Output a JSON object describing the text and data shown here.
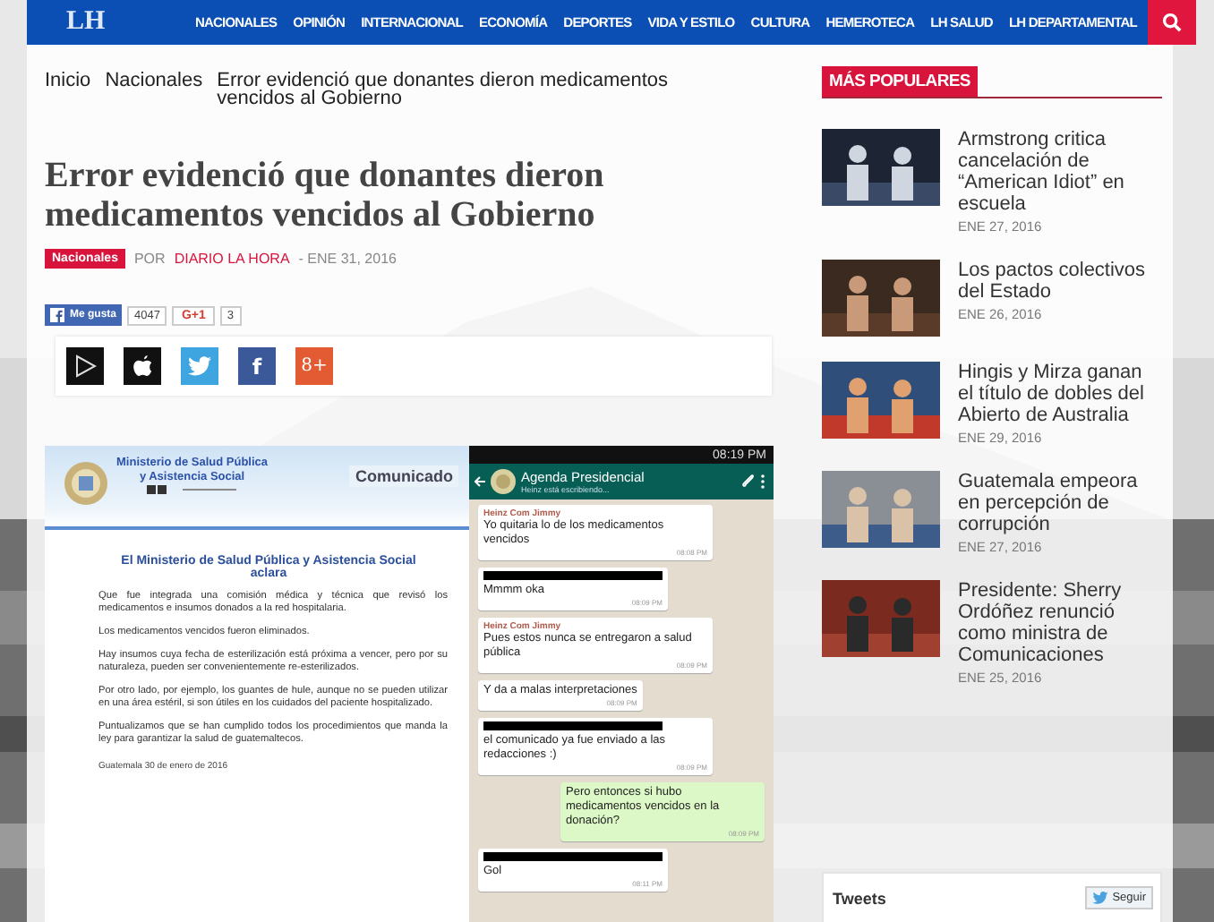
{
  "nav": {
    "logo": "LH",
    "items": [
      "NACIONALES",
      "OPINIÓN",
      "INTERNACIONAL",
      "ECONOMÍA",
      "DEPORTES",
      "VIDA Y ESTILO",
      "CULTURA",
      "HEMEROTECA",
      "LH SALUD",
      "LH DEPARTAMENTAL"
    ]
  },
  "breadcrumb": [
    "Inicio",
    "Nacionales",
    "Error evidenció que donantes dieron medicamentos vencidos al Gobierno"
  ],
  "article": {
    "title": "Error evidenció que donantes dieron medicamentos vencidos al Gobierno",
    "category": "Nacionales",
    "by": "POR",
    "author": "DIARIO LA HORA",
    "date": "- ENE 31, 2016"
  },
  "social": {
    "like_label": "Me gusta",
    "like_count": "4047",
    "plus_label": "G+1",
    "plus_count": "3"
  },
  "share_buttons": [
    {
      "kind": "play"
    },
    {
      "kind": "apple"
    },
    {
      "kind": "twitter"
    },
    {
      "kind": "facebook",
      "glyph": "f"
    },
    {
      "kind": "gplus",
      "glyph": "8+"
    }
  ],
  "communique": {
    "ministry": [
      "Ministerio de Salud Pública",
      "y Asistencia Social"
    ],
    "badge": "Comunicado",
    "heading": "El Ministerio de Salud Pública y Asistencia Social aclara",
    "paragraphs": [
      "Que fue integrada una comisión médica y técnica que revisó los medicamentos e insumos donados a la red hospitalaria.",
      "Los medicamentos vencidos fueron eliminados.",
      "Hay insumos cuya fecha de esterilización está próxima a vencer, pero por su naturaleza, pueden ser convenientemente re-esterilizados.",
      "Por otro lado, por ejemplo, los guantes de hule, aunque no se pueden utilizar en una área estéril, si son útiles en los cuidados del paciente hospitalizado.",
      "Puntualizamos que se han cumplido todos los procedimientos que manda la ley para garantizar la salud de guatemaltecos."
    ],
    "dateline": "Guatemala 30 de enero de 2016"
  },
  "chat": {
    "clock": "08:19 PM",
    "title": "Agenda Presidencial",
    "status": "Heinz está escribiendo...",
    "messages": [
      {
        "sender": "Heinz Com Jimmy",
        "text": "Yo quitaria lo de los medicamentos vencidos",
        "time": "08:08 PM",
        "outgoing": false,
        "redacted": false
      },
      {
        "text": "Mmmm oka",
        "time": "08:09 PM",
        "outgoing": false,
        "redacted": true
      },
      {
        "sender": "Heinz Com Jimmy",
        "text": "Pues estos nunca se entregaron a salud pública",
        "time": "08:09 PM",
        "outgoing": false,
        "redacted": false
      },
      {
        "text": "Y da a malas interpretaciones",
        "time": "08:09 PM",
        "outgoing": false,
        "redacted": false
      },
      {
        "text": "el comunicado ya fue enviado a las redacciones :)",
        "time": "08:09 PM",
        "outgoing": false,
        "redacted": true
      },
      {
        "text": "Pero  entonces si hubo medicamentos vencidos en la donación?",
        "time": "08:09 PM",
        "outgoing": true,
        "redacted": false
      },
      {
        "text": "Gol",
        "time": "08:11 PM",
        "outgoing": false,
        "redacted": true
      }
    ]
  },
  "sidebar": {
    "heading": "MÁS POPULARES",
    "items": [
      {
        "title": "Armstrong critica cancelación de “American Idiot” en escuela",
        "date": "ENE 27, 2016"
      },
      {
        "title": "Los pactos colectivos del Estado",
        "date": "ENE 26, 2016"
      },
      {
        "title": "Hingis y Mirza ganan el título de dobles del Abierto de Australia",
        "date": "ENE 29, 2016"
      },
      {
        "title": "Guatemala empeora en percepción de corrupción",
        "date": "ENE 27, 2016"
      },
      {
        "title": "Presidente: Sherry Ordóñez renunció como ministra de Comunicaciones",
        "date": "ENE 25, 2016"
      }
    ]
  },
  "tweets": {
    "title": "Tweets",
    "follow": "Seguir"
  }
}
